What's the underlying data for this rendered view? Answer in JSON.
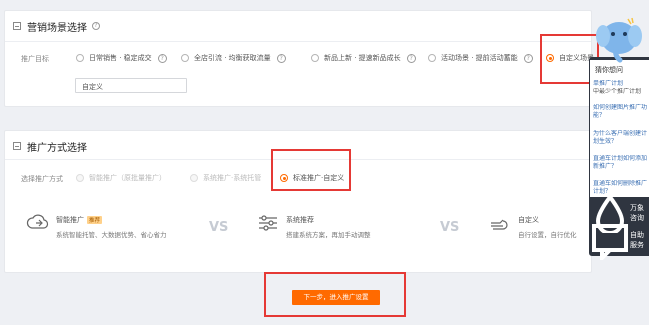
{
  "marketing_scene": {
    "title": "营销场景选择",
    "label": "推广目标",
    "options": [
      {
        "label": "日常销售 · 稳定成交"
      },
      {
        "label": "全店引流 · 均衡获取流量"
      },
      {
        "label": "新品上新 · 提速新品成长"
      },
      {
        "label": "活动场景 · 提前活动蓄能"
      },
      {
        "label": "自定义场景"
      }
    ],
    "selected_index": 4,
    "custom_input_value": "自定义"
  },
  "promotion_method": {
    "title": "推广方式选择",
    "label": "选择推广方式",
    "options": [
      {
        "label": "智能推广（原批量推广）",
        "disabled": true
      },
      {
        "label": "系统推广·系统托管",
        "disabled": true
      },
      {
        "label": "标准推广·自定义",
        "disabled": false
      }
    ],
    "selected_index": 2,
    "features": [
      {
        "title": "智能推广",
        "tag": "推荐",
        "desc": "系统智能托管、大数据优势、省心省力",
        "icon": "cloud-icon"
      },
      {
        "title": "系统推荐",
        "desc": "搭建系统方案，再加手动调整",
        "icon": "sliders-icon"
      },
      {
        "title": "自定义",
        "desc": "自行设置，自行优化",
        "icon": "hand-icon"
      }
    ],
    "vs_label": "VS"
  },
  "next_button": {
    "label": "下一步，进入推广设置"
  },
  "help_panel": {
    "title": "猜你想问",
    "faqs": [
      "单推广计划",
      "中最少个推广计划",
      "如何创建图片推广功能？",
      "为什么客户端创建计划生效？",
      "直通车计划如何添加新推广？",
      "直通车如何删除推广计划？"
    ],
    "services": [
      {
        "label": "万象咨询",
        "icon": "droplet-icon"
      },
      {
        "label": "自助服务",
        "icon": "chat-icon"
      }
    ]
  },
  "colors": {
    "accent": "#ff6a00",
    "highlight_box": "#e53935",
    "panel_bg": "#2f3540"
  }
}
